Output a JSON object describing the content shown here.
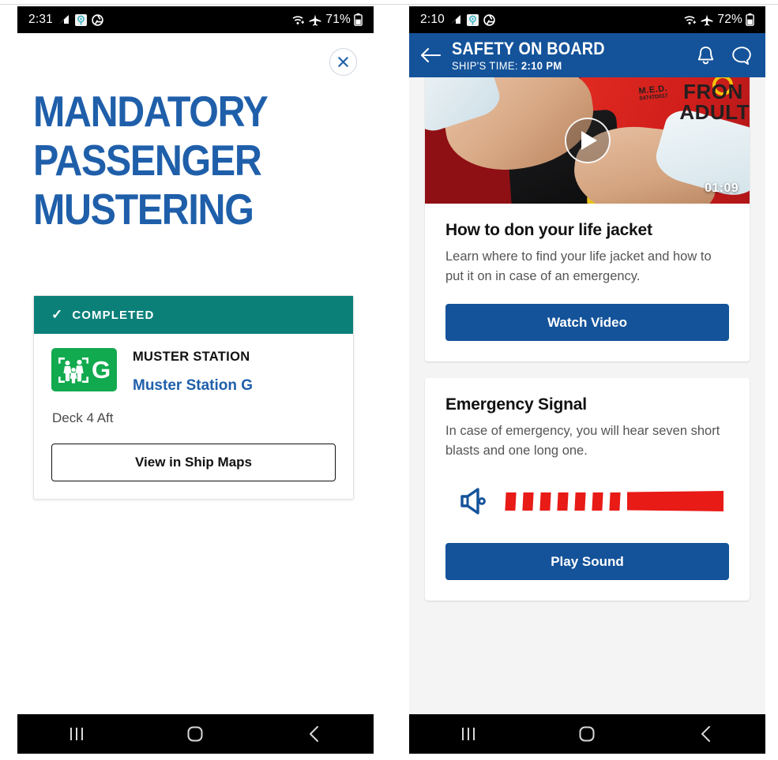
{
  "left_phone": {
    "status_bar": {
      "time": "2:31",
      "battery": "71%",
      "left_icons": [
        "signal-icon",
        "location-icon",
        "aperture-icon"
      ],
      "right_icons": [
        "wifi-icon",
        "airplane-mode-icon",
        "battery-icon"
      ]
    },
    "close_label": "×",
    "hero_title_lines": [
      "MANDATORY",
      "PASSENGER",
      "MUSTERING"
    ],
    "card": {
      "status_label": "COMPLETED",
      "status_check": "✓",
      "badge_letter": "G",
      "station_label": "MUSTER STATION",
      "station_name": "Muster Station G",
      "deck": "Deck 4 Aft",
      "maps_button": "View in Ship Maps"
    },
    "nav_bar": [
      "recents-button",
      "home-button",
      "back-button"
    ]
  },
  "right_phone": {
    "status_bar": {
      "time": "2:10",
      "battery": "72%",
      "left_icons": [
        "signal-icon",
        "location-icon",
        "aperture-icon"
      ],
      "right_icons": [
        "wifi-icon",
        "airplane-mode-icon",
        "battery-icon"
      ]
    },
    "header": {
      "title": "SAFETY ON BOARD",
      "subtitle_label": "SHIP'S TIME:",
      "subtitle_value": "2:10 PM",
      "back_icon": "arrow-left-icon",
      "bell_icon": "bell-icon",
      "chat_icon": "chat-bubble-icon"
    },
    "video_card": {
      "duration": "01:09",
      "thumb_text": {
        "brand": "M.E.D.",
        "code": "04747D017",
        "line1": "FRON",
        "line2": "ADULT"
      },
      "title": "How to don your life jacket",
      "description": "Learn where to find your life jacket and how to put it on in case of an emergency.",
      "button": "Watch Video"
    },
    "signal_card": {
      "title": "Emergency Signal",
      "description": "In case of emergency, you will hear seven short blasts and one long one.",
      "short_blasts": 7,
      "long_blasts": 1,
      "button": "Play Sound"
    },
    "nav_bar": [
      "recents-button",
      "home-button",
      "back-button"
    ]
  },
  "colors": {
    "brand_blue": "#14539a",
    "title_blue": "#1f5faa",
    "teal": "#0b8079",
    "badge_green": "#12aa4f",
    "signal_red": "#e81b17",
    "page_bg": "#f4f4f4"
  }
}
